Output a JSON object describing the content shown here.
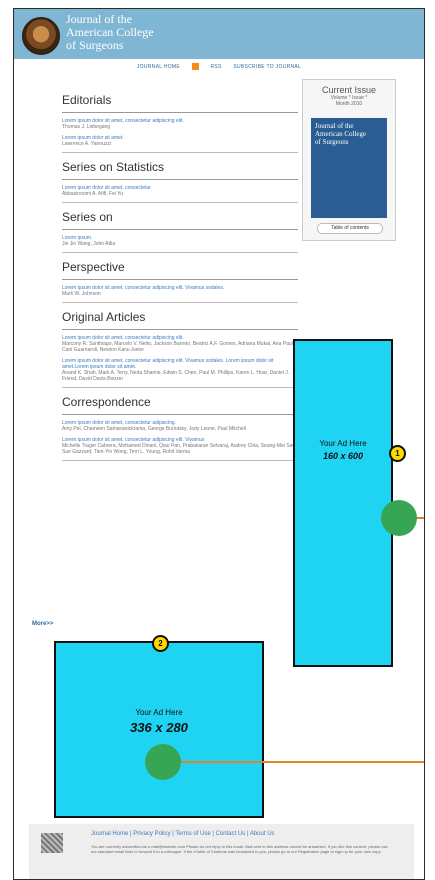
{
  "header": {
    "line1": "Journal of the",
    "line2": "American College",
    "line3": "of Surgeons"
  },
  "nav": {
    "home": "JOURNAL HOME",
    "rss": "RSS",
    "subscribe": "SUBSCRIBE TO JOURNAL"
  },
  "sections": [
    {
      "title": "Editorials",
      "articles": [
        {
          "link": "Lorem ipsum dolor sit amet, consectetur adipiscing elit.",
          "authors": "Thomas J. Liebegang"
        },
        {
          "link": "Lorem ipsum dolor sit amet.",
          "authors": "Lawrence A. Yannuzzi"
        }
      ]
    },
    {
      "title": "Series on Statistics",
      "articles": [
        {
          "link": "Lorem ipsum dolor sit amet, consectetur",
          "authors": "Abbasinoomi A. Afifi, Fei Yu"
        }
      ]
    },
    {
      "title": "Series on",
      "articles": [
        {
          "link": "Lorem ipsum.",
          "authors": "Jie Jin Wang, John Attia"
        }
      ]
    },
    {
      "title": "Perspective",
      "articles": [
        {
          "link": "Lorem ipsum dolor sit amet, consectetur adipiscing elit. Vivamus sodales.",
          "authors": "Mark W. Johnson"
        }
      ]
    },
    {
      "title": "Original Articles",
      "articles": [
        {
          "link": "Lorem ipsum dolor sit amet, consectetur adipiscing elit.",
          "authors": "Marcony R. Santhiago, Marcelo V. Netto, Jackson Barreto, Beatriz A.F. Gomes, Adriana Mukai, Ana Paula Cani Guarnaroli, Newton Kara-Junior"
        },
        {
          "link": "Lorem ipsum dolor sit amet, consectetur adipiscing elit. Vivamus sodales. Lorem ipsum dolor sit amet.Lorem ipsum dolor sit amet.",
          "authors": "Anand K. Shah, Mark A. Terry, Neda Shamie, Edwin S. Chen, Paul M. Phillips, Karen L. Hoar, Daniel J. Friend, David Davis-Boozer"
        }
      ]
    },
    {
      "title": "Correspondence",
      "articles": [
        {
          "link": "Lorem ipsum dolor sit amet, consectetur adipiscing.",
          "authors": "Amy Pei, Chameen Samarawickrama, George Burlutsky, Jody Leone, Paul Mitchell"
        },
        {
          "link": "Lorem ipsum dolor sit amet, consectetur adipiscing elit. Vivamus",
          "authors": "Michelle Trager Cabrera, Mohamed Dinani, Qiao Pan, Prabakaran Selvaraj, Audrey Chia, Seang-Mei Saw, Sue Gazzard, Tien-Yin Wong, Terri L. Young, Rohit Varma"
        }
      ]
    }
  ],
  "sidebar": {
    "title": "Current Issue",
    "volume": "Volume *   Issue *",
    "date": "Month 2010",
    "cover_line1": "Journal of the",
    "cover_line2": "American College",
    "cover_line3": "of Surgeons",
    "toc": "Table of contents"
  },
  "ads": {
    "a1": {
      "label": "Your Ad Here",
      "size": "160 x 600",
      "marker": "1"
    },
    "a2": {
      "label": "Your Ad Here",
      "size": "336 x 280",
      "marker": "2"
    }
  },
  "more": "More>>",
  "footer": {
    "links": "Journal Home  |  Privacy Policy  |  Terms of Use  |  Contact Us  |  About Us",
    "text": "You are currently subscribed as e-mail@elsevier.com Please do not reply to this email. Mail sent to this address cannot be answered. If you like this content, please use our standard email links to forward it to a colleague. If the eTable of Contents was forwarded to you, please go to our Registration page to sign up for your own copy."
  },
  "colors": {
    "header": "#7fb6d3",
    "ad": "#1ed4f2",
    "marker": "#ffd900",
    "dot": "#36a655",
    "line": "#e0842a"
  }
}
